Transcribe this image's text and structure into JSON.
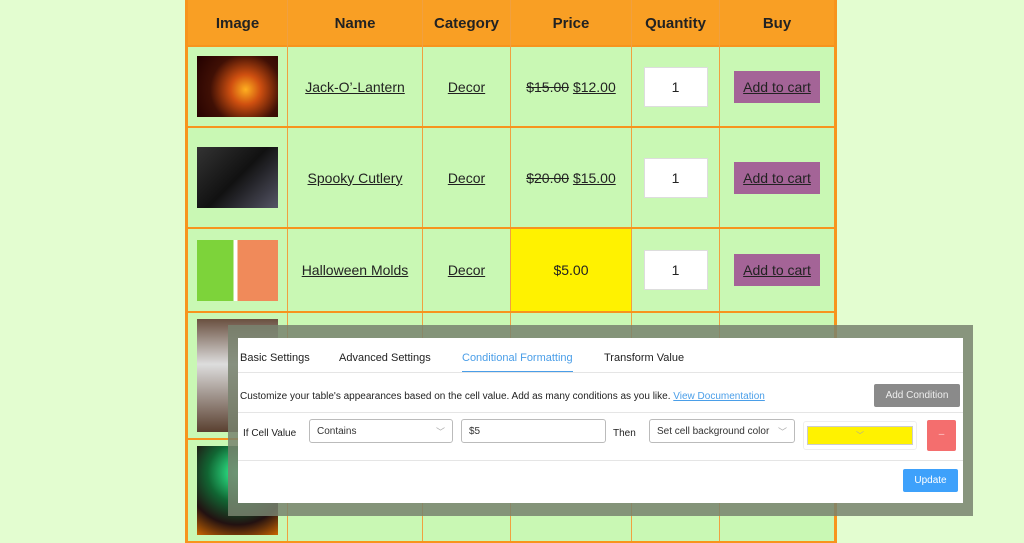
{
  "table": {
    "headers": [
      "Image",
      "Name",
      "Category",
      "Price",
      "Quantity",
      "Buy"
    ],
    "rows": [
      {
        "image": "jack-o-lantern-photo",
        "name": "Jack-O’-Lantern",
        "category": "Decor",
        "old_price": "$15.00",
        "price": "$12.00",
        "quantity": "1",
        "buy": "Add to cart"
      },
      {
        "image": "spooky-cutlery-photo",
        "name": "Spooky Cutlery",
        "category": "Decor",
        "old_price": "$20.00",
        "price": "$15.00",
        "quantity": "1",
        "buy": "Add to cart"
      },
      {
        "image": "halloween-molds-photo",
        "name": "Halloween Molds",
        "category": "Decor",
        "old_price": "",
        "price": "$5.00",
        "quantity": "1",
        "buy": "Add to cart",
        "highlight": "#fff200"
      }
    ]
  },
  "panel": {
    "tabs": [
      "Basic Settings",
      "Advanced Settings",
      "Conditional Formatting",
      "Transform Value"
    ],
    "active_tab": "Conditional Formatting",
    "description": "Customize your table's appearances based on the cell value. Add as many conditions as you like.",
    "doc_link": "View Documentation",
    "add_condition": "Add Condition",
    "condition": {
      "if_label": "If Cell Value",
      "operator": "Contains",
      "value": "$5",
      "then_label": "Then",
      "action": "Set cell background color",
      "color": "#fff200",
      "remove": "–"
    },
    "update": "Update"
  },
  "colors": {
    "header": "#f99f24",
    "row": "#c9f8b4",
    "cart": "#a46497",
    "accent": "#4a9ee8"
  }
}
